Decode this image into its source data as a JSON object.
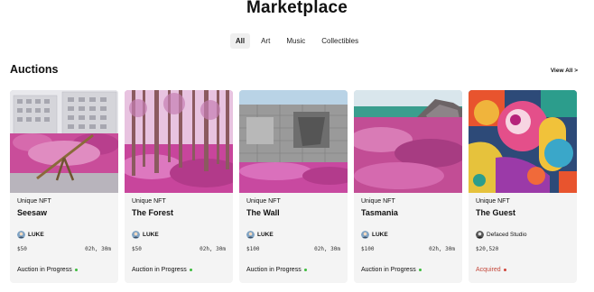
{
  "page": {
    "title": "Marketplace"
  },
  "tabs": [
    {
      "label": "All",
      "active": true
    },
    {
      "label": "Art",
      "active": false
    },
    {
      "label": "Music",
      "active": false
    },
    {
      "label": "Collectibles",
      "active": false
    }
  ],
  "auctions": {
    "title": "Auctions",
    "view_all": "View All >"
  },
  "colors": {
    "in_progress": "#3dbb3d",
    "acquired": "#d0453a",
    "acquired_text": "#c4473a"
  },
  "cards": [
    {
      "kind": "Unique NFT",
      "name": "Seesaw",
      "owner": "LUKE",
      "price": "$50",
      "time": "02h, 30m",
      "status": "Auction in Progress",
      "status_type": "in_progress",
      "image_icon": "seesaw-photo"
    },
    {
      "kind": "Unique NFT",
      "name": "The Forest",
      "owner": "LUKE",
      "price": "$50",
      "time": "02h, 30m",
      "status": "Auction in Progress",
      "status_type": "in_progress",
      "image_icon": "forest-photo"
    },
    {
      "kind": "Unique NFT",
      "name": "The Wall",
      "owner": "LUKE",
      "price": "$100",
      "time": "02h, 30m",
      "status": "Auction in Progress",
      "status_type": "in_progress",
      "image_icon": "wall-photo"
    },
    {
      "kind": "Unique NFT",
      "name": "Tasmania",
      "owner": "LUKE",
      "price": "$100",
      "time": "02h, 30m",
      "status": "Auction in Progress",
      "status_type": "in_progress",
      "image_icon": "tasmania-photo"
    },
    {
      "kind": "Unique NFT",
      "name": "The Guest",
      "owner": "Defaced Studio",
      "price": "$20,520",
      "time": "",
      "status": "Acquired",
      "status_type": "acquired",
      "image_icon": "guest-artwork"
    }
  ]
}
